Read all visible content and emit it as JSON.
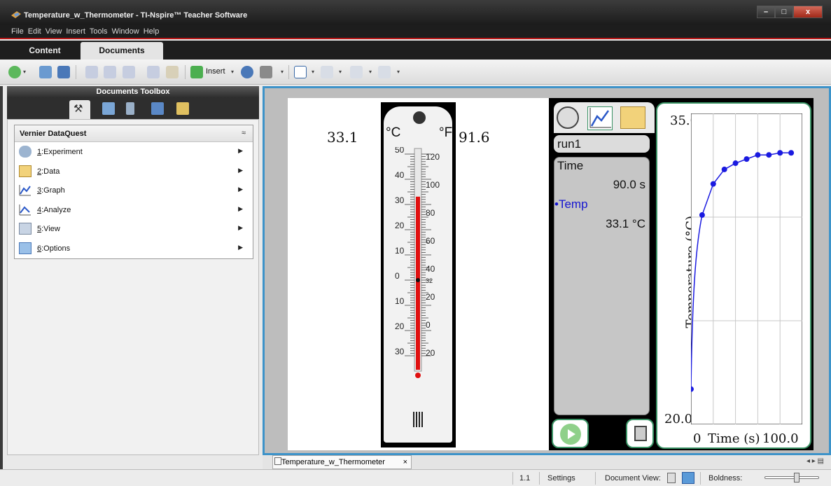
{
  "window": {
    "title": "Temperature_w_Thermometer - TI-Nspire™ Teacher Software"
  },
  "menu": [
    "File",
    "Edit",
    "View",
    "Insert",
    "Tools",
    "Window",
    "Help"
  ],
  "tabs": {
    "content": "Content",
    "documents": "Documents"
  },
  "toolbar": {
    "insert_label": "Insert"
  },
  "toolbox": {
    "title": "Documents Toolbox",
    "panel_title": "Vernier DataQuest",
    "items": [
      {
        "num": "1",
        "label": ":Experiment"
      },
      {
        "num": "2",
        "label": ":Data"
      },
      {
        "num": "3",
        "label": ":Graph"
      },
      {
        "num": "4",
        "label": ":Analyze"
      },
      {
        "num": "5",
        "label": ":View"
      },
      {
        "num": "6",
        "label": ":Options"
      }
    ]
  },
  "thermometer": {
    "celsius_readout": "33.1",
    "fahrenheit_readout": "91.6",
    "celsius_unit": "°C",
    "fahrenheit_unit": "°F",
    "celsius_ticks": [
      "50",
      "40",
      "30",
      "20",
      "10",
      "0",
      "10",
      "20",
      "30"
    ],
    "fahrenheit_ticks": [
      "120",
      "100",
      "80",
      "60",
      "40",
      "32",
      "20",
      "0",
      "20"
    ],
    "level_celsius": 33.1
  },
  "dataquest": {
    "run": "run1",
    "time_label": "Time",
    "time_value": "90.0 s",
    "temp_label": "•Temp",
    "temp_value": "33.1 °C"
  },
  "chart_data": {
    "type": "scatter",
    "x": [
      0,
      10,
      20,
      30,
      40,
      50,
      60,
      70,
      80,
      90
    ],
    "y": [
      21.7,
      30.1,
      31.6,
      32.3,
      32.6,
      32.8,
      33.0,
      33.0,
      33.1,
      33.1
    ],
    "xlabel": "Time (s)",
    "ylabel": "Temperature (°C)",
    "xlim": [
      0,
      100.0
    ],
    "ylim": [
      20.0,
      35.0
    ],
    "x_min_label": "0",
    "x_max_label": "100.0",
    "y_min_label": "20.0",
    "y_max_label": "35.0",
    "grid": true,
    "colors": {
      "series": "#1a1ae0"
    }
  },
  "doc_tab": {
    "name": "Temperature_w_Thermometer",
    "close": "×"
  },
  "status": {
    "page": "1.1",
    "settings": "Settings",
    "document_view": "Document View:",
    "boldness": "Boldness:"
  }
}
